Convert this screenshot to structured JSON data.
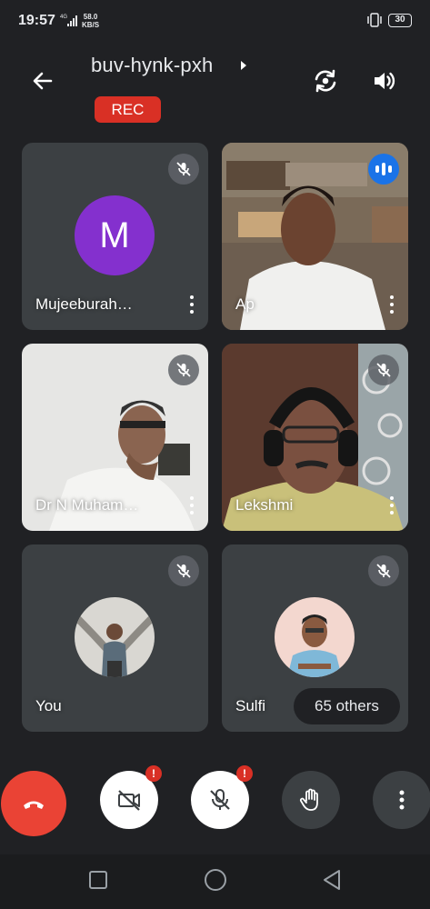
{
  "status_bar": {
    "time": "19:57",
    "network": "4G",
    "speed_value": "58.0",
    "speed_unit": "KB/S",
    "battery": "30"
  },
  "header": {
    "meeting_code": "buv-hynk-pxh",
    "recording_label": "REC"
  },
  "participants": [
    {
      "name": "Mujeeburah…",
      "avatar_letter": "M",
      "avatar_color": "#8430ce",
      "state": "mic-off"
    },
    {
      "name": "Ap",
      "state": "speaking"
    },
    {
      "name": "Dr N Muham…",
      "state": "mic-off"
    },
    {
      "name": "Lekshmi",
      "state": "mic-off"
    },
    {
      "name": "You",
      "state": "mic-off"
    },
    {
      "name": "Sulfi",
      "state": "mic-off"
    }
  ],
  "others_chip": "65 others",
  "controls": {
    "cam_alert": "!",
    "mic_alert": "!"
  },
  "colors": {
    "background": "#202124",
    "tile": "#3c4043",
    "rec": "#d93025",
    "end_call": "#ea4335",
    "speaking": "#1a73e8"
  }
}
